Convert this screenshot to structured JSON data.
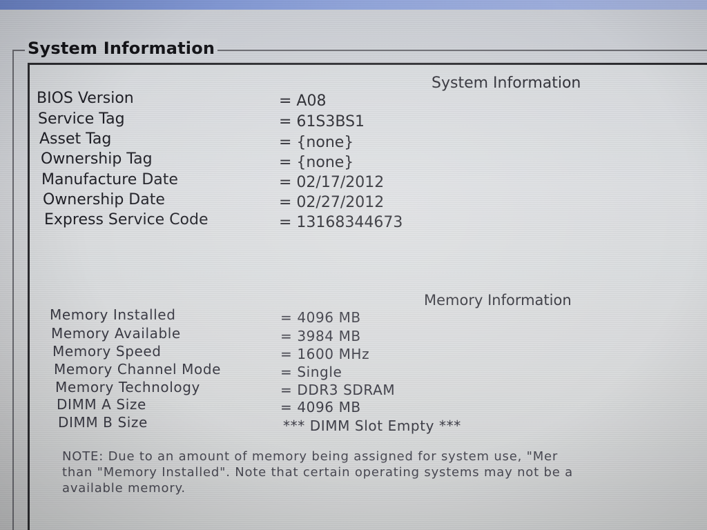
{
  "group_title": "System Information",
  "system_section": {
    "title": "System Information",
    "rows": [
      {
        "label": "BIOS Version",
        "value": "= A08"
      },
      {
        "label": "Service Tag",
        "value": "= 61S3BS1"
      },
      {
        "label": "Asset Tag",
        "value": "= {none}"
      },
      {
        "label": "Ownership Tag",
        "value": "= {none}"
      },
      {
        "label": "Manufacture Date",
        "value": "= 02/17/2012"
      },
      {
        "label": "Ownership Date",
        "value": "= 02/27/2012"
      },
      {
        "label": "Express Service Code",
        "value": "= 13168344673"
      }
    ]
  },
  "memory_section": {
    "title": "Memory Information",
    "rows": [
      {
        "label": "Memory Installed",
        "value": "= 4096 MB"
      },
      {
        "label": "Memory Available",
        "value": "= 3984 MB"
      },
      {
        "label": "Memory Speed",
        "value": "= 1600 MHz"
      },
      {
        "label": "Memory Channel Mode",
        "value": "= Single"
      },
      {
        "label": "Memory Technology",
        "value": "= DDR3 SDRAM"
      },
      {
        "label": "DIMM A Size",
        "value": "= 4096 MB"
      },
      {
        "label": "DIMM B Size",
        "value": "*** DIMM Slot Empty ***"
      }
    ]
  },
  "note": {
    "lines": [
      "NOTE: Due to an amount of memory being assigned for system use, \"Mer",
      "than \"Memory Installed\". Note that certain operating systems may not be a",
      "available memory."
    ]
  }
}
